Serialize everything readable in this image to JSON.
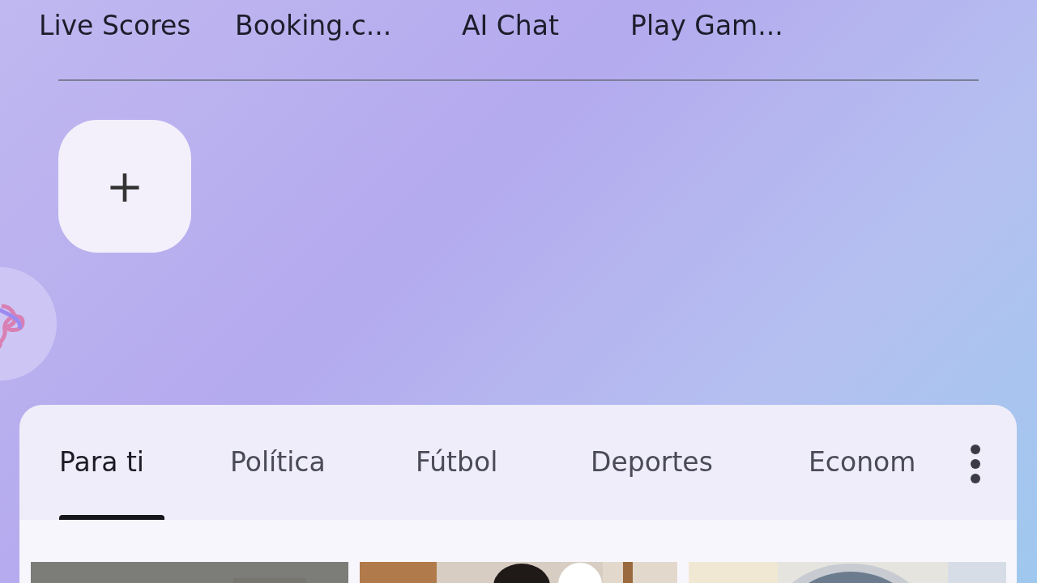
{
  "shortcuts": [
    {
      "label": "Live Scores"
    },
    {
      "label": "Booking.c..."
    },
    {
      "label": "AI Chat"
    },
    {
      "label": "Play Gam..."
    }
  ],
  "add_button": {
    "label": "+"
  },
  "news": {
    "tabs": [
      {
        "label": "Para ti",
        "selected": true
      },
      {
        "label": "Política",
        "selected": false
      },
      {
        "label": "Fútbol",
        "selected": false
      },
      {
        "label": "Deportes",
        "selected": false
      },
      {
        "label": "Econom",
        "selected": false
      }
    ]
  }
}
